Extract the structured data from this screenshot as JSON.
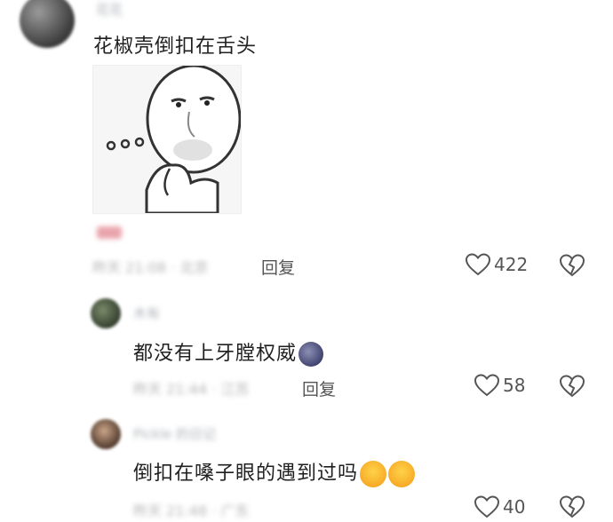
{
  "comments": [
    {
      "username": "花花",
      "text": "花椒壳倒扣在舌头",
      "meta": "昨天 21:08 · 北京",
      "reply_label": "回复",
      "likes": "422"
    },
    {
      "username": "木有",
      "text": "都没有上牙膛权威",
      "emoji": "new-moon-face",
      "meta": "昨天 21:44 · 江苏",
      "reply_label": "回复",
      "likes": "58"
    },
    {
      "username": "Pickle 的日记",
      "text": "倒扣在嗓子眼的遇到过吗",
      "emoji": "loudly-crying-face",
      "meta": "昨天 21:48 · 广东",
      "likes": "40"
    }
  ],
  "colors": {
    "icon": "#555555",
    "muted": "#b3b3b3",
    "text": "#1f1f1f"
  }
}
